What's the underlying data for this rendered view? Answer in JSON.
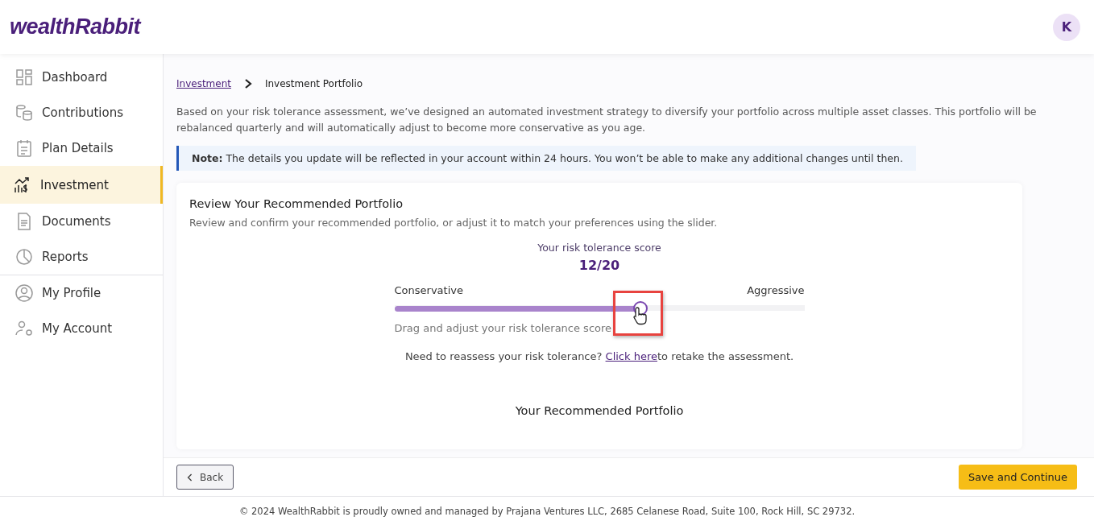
{
  "header": {
    "logo": "wealthRabbit",
    "avatar": "K"
  },
  "sidebar": {
    "groups": [
      [
        {
          "label": "Dashboard",
          "selected": false
        },
        {
          "label": "Contributions",
          "selected": false
        },
        {
          "label": "Plan Details",
          "selected": false
        },
        {
          "label": "Investment",
          "selected": true
        },
        {
          "label": "Documents",
          "selected": false
        },
        {
          "label": "Reports",
          "selected": false
        }
      ],
      [
        {
          "label": "My Profile",
          "selected": false
        },
        {
          "label": "My Account",
          "selected": false
        }
      ]
    ]
  },
  "breadcrumb": {
    "link": "Investment",
    "current": "Investment Portfolio"
  },
  "intro": "Based on your risk tolerance assessment, we’ve designed an automated investment strategy to diversify your portfolio across multiple asset classes. This portfolio will be rebalanced quarterly and will automatically adjust to become more conservative as you age.",
  "note": "**Note:** The details you update will be reflected in your account within 24 hours. You won’t be able to make any additional changes until then.",
  "card": {
    "title": "Review Your Recommended Portfolio",
    "subtitle": "Review and confirm your recommended portfolio, or adjust it to match your preferences using the slider.",
    "score_label": "Your risk tolerance score",
    "score": "12/20",
    "slider": {
      "min_label": "Conservative",
      "max_label": "Aggressive",
      "level": 0.6,
      "hint": "Drag and adjust your risk tolerance score"
    },
    "reassess": {
      "before": "Need to reassess your risk tolerance?",
      "link": "Click here",
      "after": "to retake the assessment."
    },
    "section_title": "Your Recommended Portfolio"
  },
  "actions": {
    "back": "Back",
    "next": "Save and Continue"
  },
  "footer": "© 2024 WealthRabbit is proudly owned and managed by Prajana Ventures LLC, 2685 Celanese Road, Suite 100, Rock Hill, SC 29732."
}
